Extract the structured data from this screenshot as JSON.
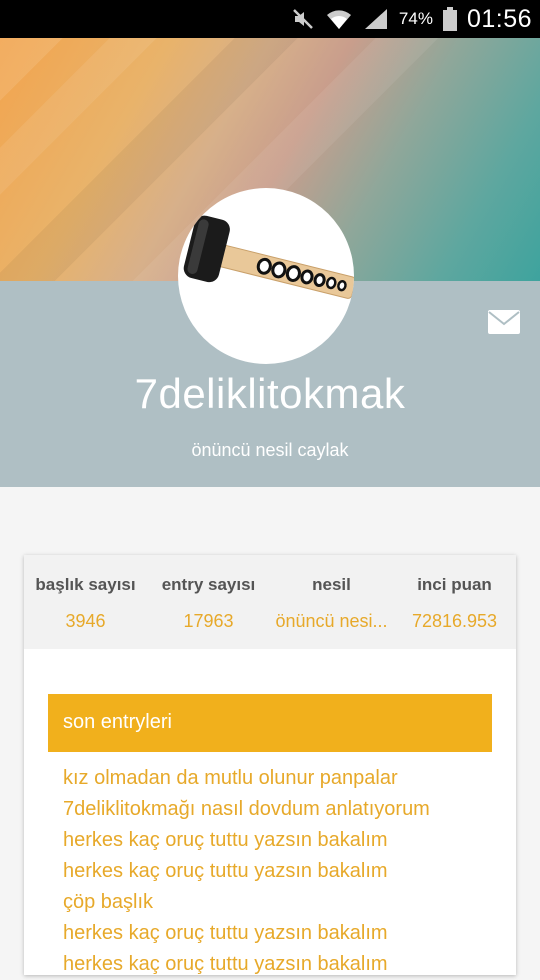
{
  "status_bar": {
    "battery_pct": "74%",
    "time": "01:56",
    "icons": [
      "mute-icon",
      "wifi-icon",
      "signal-icon",
      "battery-icon"
    ]
  },
  "profile": {
    "username": "7deliklitokmak",
    "rank": "önüncü nesil caylak",
    "avatar_icon": "mallet-icon",
    "message_icon": "envelope-icon"
  },
  "stats": [
    {
      "label": "başlık sayısı",
      "value": "3946"
    },
    {
      "label": "entry sayısı",
      "value": "17963"
    },
    {
      "label": "nesil",
      "value": "önüncü nesi..."
    },
    {
      "label": "inci puan",
      "value": "72816.953"
    }
  ],
  "recent": {
    "title": "son entryleri",
    "items": [
      "kız olmadan da mutlu olunur panpalar",
      "7deliklitokmağı nasıl dovdum anlatıyorum",
      "herkes kaç oruç tuttu yazsın bakalım",
      "herkes kaç oruç tuttu yazsın bakalım",
      "çöp başlık",
      "herkes kaç oruç tuttu yazsın bakalım",
      "herkes kaç oruç tuttu yazsın bakalım"
    ]
  },
  "colors": {
    "accent": "#f1b01c",
    "accent_text": "#e7a92a",
    "profile_band": "#afbfc4"
  }
}
